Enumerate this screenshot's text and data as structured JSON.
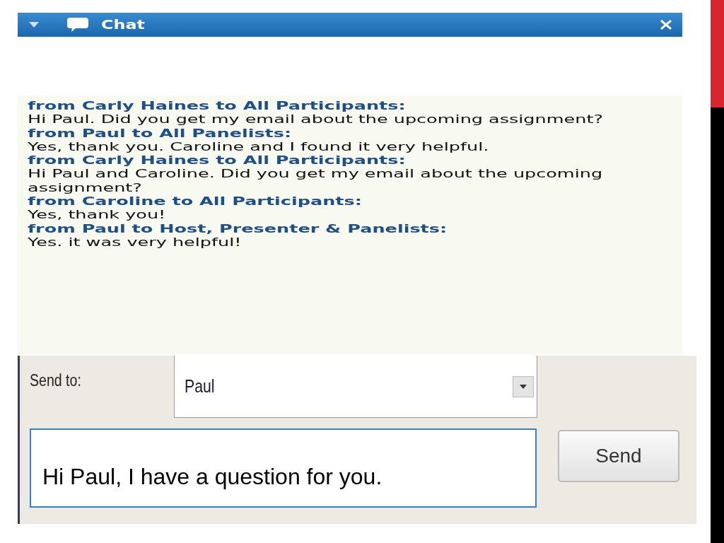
{
  "window": {
    "title": "Chat"
  },
  "messages": [
    {
      "header": "from Carly Haines to All Participants:",
      "text": "Hi Paul. Did you get my email about the upcoming assignment?"
    },
    {
      "header": "from Paul to All Panelists:",
      "text": "Yes, thank you. Caroline and I found it very helpful."
    },
    {
      "header": "from Carly Haines to All Participants:",
      "text": "Hi Paul and Caroline. Did you get my email about the upcoming assignment?"
    },
    {
      "header": "from Caroline to All Participants:",
      "text": "Yes, thank you!"
    },
    {
      "header": "from Paul to Host, Presenter & Panelists:",
      "text": "Yes. it was very helpful!"
    }
  ],
  "send_to": {
    "label": "Send to:",
    "value": "Paul"
  },
  "message_field": {
    "value": "Hi Paul, I have a question for you."
  },
  "send_button": {
    "label": "Send"
  }
}
